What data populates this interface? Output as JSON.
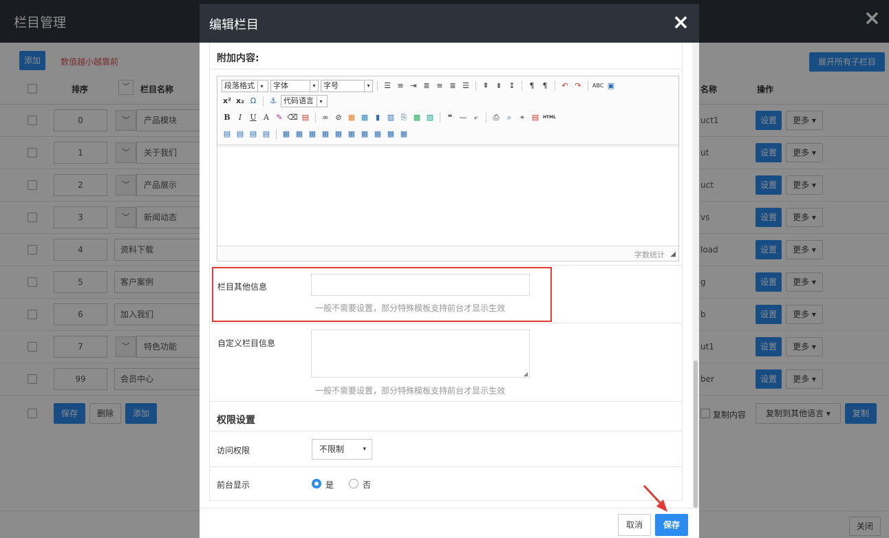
{
  "background": {
    "title": "栏目管理",
    "close_icon": "×",
    "add_button": "添加",
    "hint": "数值越小越靠前",
    "expand_button": "展开所有子栏目",
    "table": {
      "col_sort": "排序",
      "col_name": "栏目名称",
      "col_dir": "名称",
      "col_ops": "操作"
    },
    "rows": [
      {
        "sort": "0",
        "name": "产品模块",
        "has_children": true,
        "dir": "uct1"
      },
      {
        "sort": "1",
        "name": "关于我们",
        "has_children": true,
        "dir": "ut"
      },
      {
        "sort": "2",
        "name": "产品展示",
        "has_children": true,
        "dir": "uct"
      },
      {
        "sort": "3",
        "name": "新闻动态",
        "has_children": true,
        "dir": "vs"
      },
      {
        "sort": "4",
        "name": "资料下载",
        "has_children": false,
        "dir": "load"
      },
      {
        "sort": "5",
        "name": "客户案例",
        "has_children": false,
        "dir": "g"
      },
      {
        "sort": "6",
        "name": "加入我们",
        "has_children": false,
        "dir": "b"
      },
      {
        "sort": "7",
        "name": "特色功能",
        "has_children": true,
        "dir": "ut1"
      },
      {
        "sort": "99",
        "name": "会员中心",
        "has_children": false,
        "dir": "ber"
      }
    ],
    "row_set_button": "设置",
    "row_more_button": "更多",
    "footer_save": "保存",
    "footer_delete": "删除",
    "footer_add": "添加",
    "copy_content": "复制内容",
    "copy_lang_select": "复制到其他语言",
    "copy_button": "复制",
    "close_button": "关闭"
  },
  "modal": {
    "title": "编辑栏目",
    "close_icon": "×",
    "extra_content_title": "附加内容:",
    "editor": {
      "paragraph_combo": "段落格式",
      "font_combo": "字体",
      "size_combo": "字号",
      "code_lang_combo": "代码语言",
      "word_count": "字数统计"
    },
    "other_info": {
      "label": "栏目其他信息",
      "value": "",
      "help": "一般不需要设置，部分特殊模板支持前台才显示生效"
    },
    "custom_info": {
      "label": "自定义栏目信息",
      "value": "",
      "help": "一般不需要设置，部分特殊模板支持前台才显示生效"
    },
    "permission_title": "权限设置",
    "access": {
      "label": "访问权限",
      "value": "不限制"
    },
    "front_display": {
      "label": "前台显示",
      "yes": "是",
      "no": "否",
      "selected": "是"
    },
    "cancel_button": "取消",
    "save_button": "保存"
  },
  "colors": {
    "primary": "#2d8cf0",
    "header_dark": "#2e333b",
    "highlight_red": "#e53935"
  }
}
